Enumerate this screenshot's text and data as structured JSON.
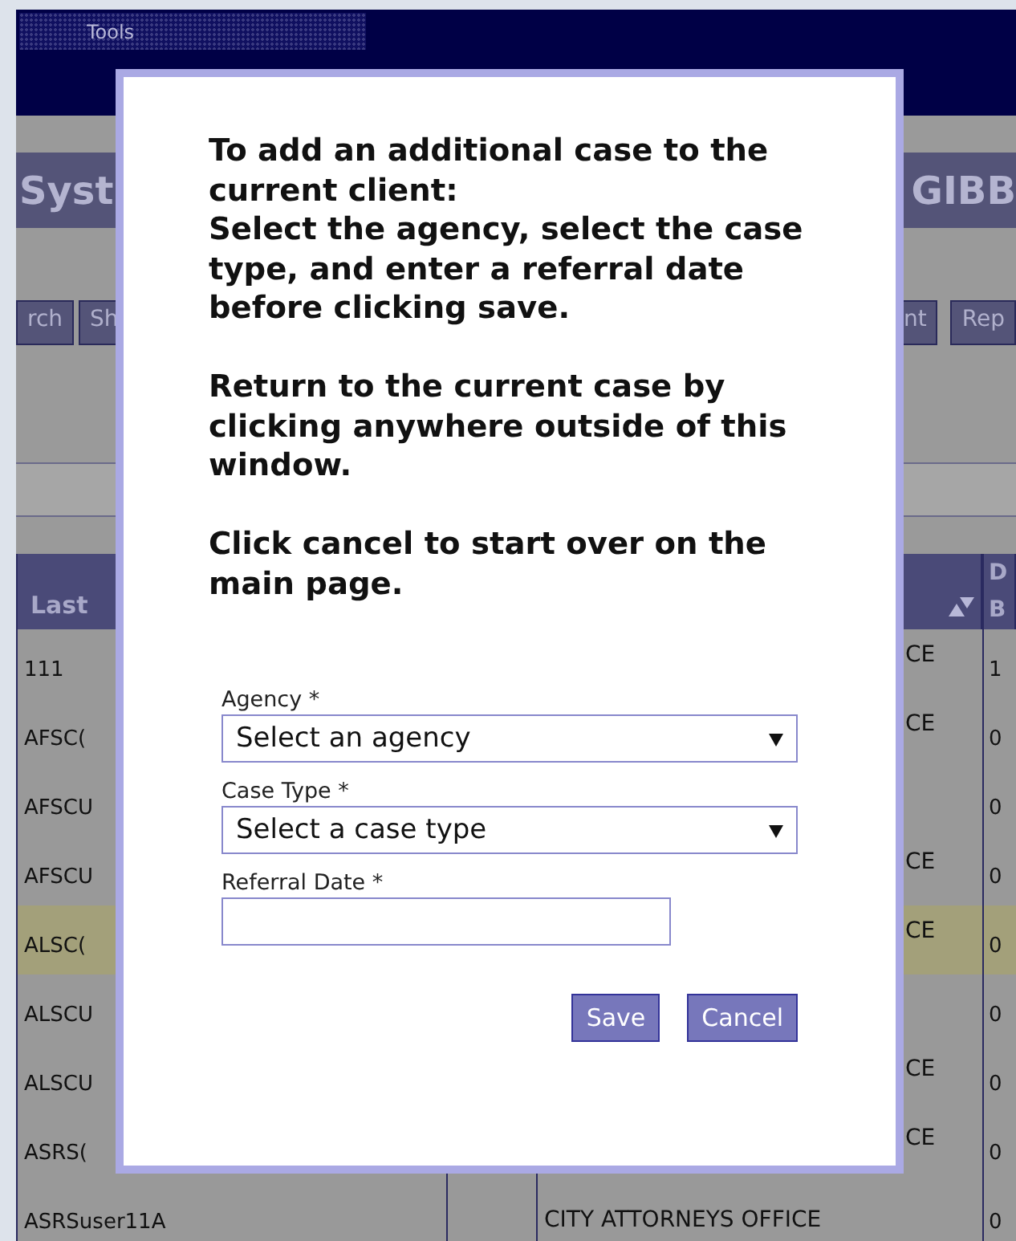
{
  "menu_bar": {
    "items": [
      "Tools"
    ]
  },
  "page_title": {
    "left": "Syst",
    "right": "GIBB"
  },
  "nav_buttons": {
    "left": [
      "rch",
      "Sh"
    ],
    "right": [
      "nt",
      "Rep"
    ]
  },
  "table": {
    "columns": {
      "column_1": "Last",
      "column_4": [
        "D",
        "B"
      ]
    },
    "rows": [
      {
        "column_1": "111",
        "column_3_end": "CE",
        "column_4": "1",
        "selected": false
      },
      {
        "column_1": "AFSC(",
        "column_3_end": "CE",
        "column_4": "0",
        "selected": false
      },
      {
        "column_1": "AFSCU",
        "column_4": "0",
        "selected": false
      },
      {
        "column_1": "AFSCU",
        "column_3_end": "CE",
        "column_4": "0",
        "selected": false
      },
      {
        "column_1": "ALSC(",
        "column_3_end": "CE",
        "column_4": "0",
        "selected": true
      },
      {
        "column_1": "ALSCU",
        "column_4": "0",
        "selected": false
      },
      {
        "column_1": "ALSCU",
        "column_3_end": "CE",
        "column_4": "0",
        "selected": false
      },
      {
        "column_1": "ASRS(",
        "column_3_end": "CE",
        "column_4": "0",
        "selected": false
      },
      {
        "column_1": "ASRSuser11A",
        "column_3": "CITY ATTORNEYS OFFICE",
        "column_4": "0",
        "selected": false
      }
    ]
  },
  "dialog": {
    "instructions": [
      "To add an additional case to the current client:",
      "Select the agency, select the case type, and enter a referral date before clicking save.",
      "Return to the current case by clicking anywhere outside of this window.",
      "Click cancel to start over on the main page."
    ],
    "fields": [
      {
        "kind": "select",
        "label": "Agency *",
        "value": "Select an agency"
      },
      {
        "kind": "select",
        "label": "Case Type *",
        "value": "Select a case type"
      },
      {
        "kind": "text",
        "label": "Referral Date *"
      }
    ],
    "buttons": [
      "Save",
      "Cancel"
    ]
  }
}
